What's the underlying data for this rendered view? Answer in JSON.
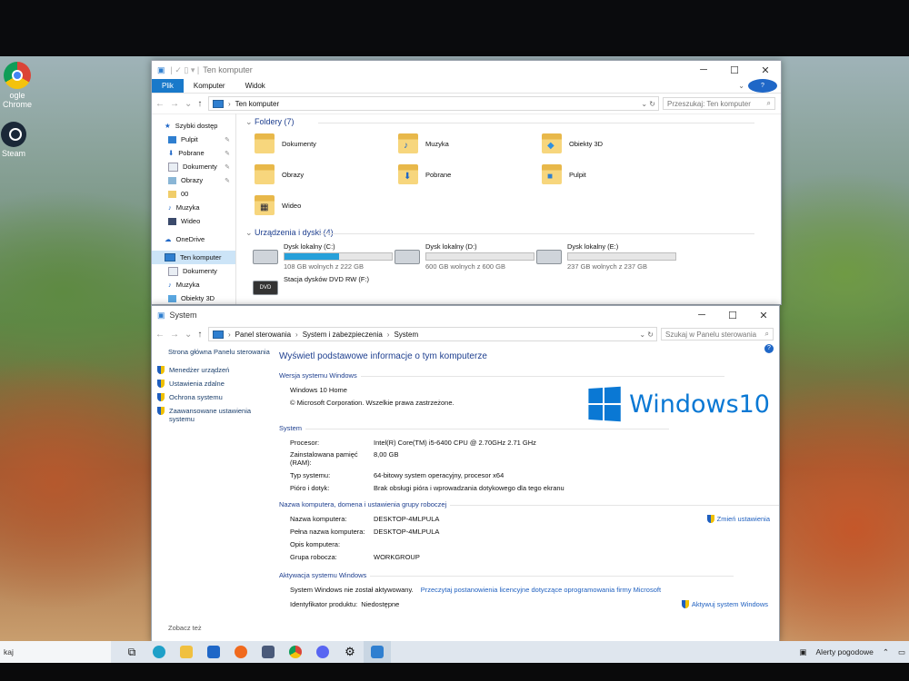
{
  "desktop": {
    "icons": [
      {
        "label": "ogle Chrome",
        "icon": "chrome-icon"
      },
      {
        "label": "Steam",
        "icon": "steam-icon"
      }
    ]
  },
  "explorer": {
    "title": "Ten komputer",
    "ribbon_tabs": [
      "Plik",
      "Komputer",
      "Widok"
    ],
    "address": "Ten komputer",
    "search_placeholder": "Przeszukaj: Ten komputer",
    "nav": [
      {
        "label": "Szybki dostęp",
        "pinned": false
      },
      {
        "label": "Pulpit",
        "pinned": true
      },
      {
        "label": "Pobrane",
        "pinned": true
      },
      {
        "label": "Dokumenty",
        "pinned": true
      },
      {
        "label": "Obrazy",
        "pinned": true
      },
      {
        "label": "00",
        "pinned": false
      },
      {
        "label": "Muzyka",
        "pinned": false
      },
      {
        "label": "Wideo",
        "pinned": false
      },
      {
        "label": "OneDrive",
        "pinned": false
      },
      {
        "label": "Ten komputer",
        "pinned": false
      },
      {
        "label": "Dokumenty",
        "pinned": false
      },
      {
        "label": "Muzyka",
        "pinned": false
      },
      {
        "label": "Obiekty 3D",
        "pinned": false
      }
    ],
    "folders_header": "Foldery (7)",
    "folders": [
      "Dokumenty",
      "Muzyka",
      "Obiekty 3D",
      "Obrazy",
      "Pobrane",
      "Pulpit",
      "Wideo"
    ],
    "drives_header": "Urządzenia i dyski (4)",
    "drives": [
      {
        "name": "Dysk lokalny (C:)",
        "free": "108 GB wolnych z 222 GB",
        "used_fraction": 0.51
      },
      {
        "name": "Dysk lokalny (D:)",
        "free": "600 GB wolnych z 600 GB",
        "used_fraction": 0.0
      },
      {
        "name": "Dysk lokalny (E:)",
        "free": "237 GB wolnych z 237 GB",
        "used_fraction": 0.0
      },
      {
        "name": "Stacja dysków DVD RW (F:)"
      }
    ]
  },
  "system": {
    "title": "System",
    "breadcrumb": [
      "Panel sterowania",
      "System i zabezpieczenia",
      "System"
    ],
    "search_placeholder": "Szukaj w Panelu sterowania",
    "left_home": "Strona główna Panelu sterowania",
    "left_links": [
      "Menedżer urządzeń",
      "Ustawienia zdalne",
      "Ochrona systemu",
      "Zaawansowane ustawienia systemu"
    ],
    "see_also": "Zobacz też",
    "heading": "Wyświetl podstawowe informacje o tym komputerze",
    "edition_group": "Wersja systemu Windows",
    "edition": "Windows 10 Home",
    "copyright": "© Microsoft Corporation. Wszelkie prawa zastrzeżone.",
    "logo_text": "Windows10",
    "system_group": "System",
    "specs": [
      {
        "k": "Procesor:",
        "v": "Intel(R) Core(TM) i5-6400 CPU @ 2.70GHz   2.71 GHz"
      },
      {
        "k": "Zainstalowana pamięć (RAM):",
        "v": "8,00 GB"
      },
      {
        "k": "Typ systemu:",
        "v": "64-bitowy system operacyjny, procesor x64"
      },
      {
        "k": "Pióro i dotyk:",
        "v": "Brak obsługi pióra i wprowadzania dotykowego dla tego ekranu"
      }
    ],
    "name_group": "Nazwa komputera, domena i ustawienia grupy roboczej",
    "names": [
      {
        "k": "Nazwa komputera:",
        "v": "DESKTOP-4MLPULA"
      },
      {
        "k": "Pełna nazwa komputera:",
        "v": "DESKTOP-4MLPULA"
      },
      {
        "k": "Opis komputera:",
        "v": ""
      },
      {
        "k": "Grupa robocza:",
        "v": "WORKGROUP"
      }
    ],
    "change_settings": "Zmień ustawienia",
    "activation_group": "Aktywacja systemu Windows",
    "activation_status": "System Windows nie został aktywowany.",
    "license_link": "Przeczytaj postanowienia licencyjne dotyczące oprogramowania firmy Microsoft",
    "product_id_label": "Identyfikator produktu:",
    "product_id": "Niedostępne",
    "activate": "Aktywuj system Windows"
  },
  "taskbar": {
    "search_text": "kaj",
    "weather": "Alerty pogodowe"
  }
}
